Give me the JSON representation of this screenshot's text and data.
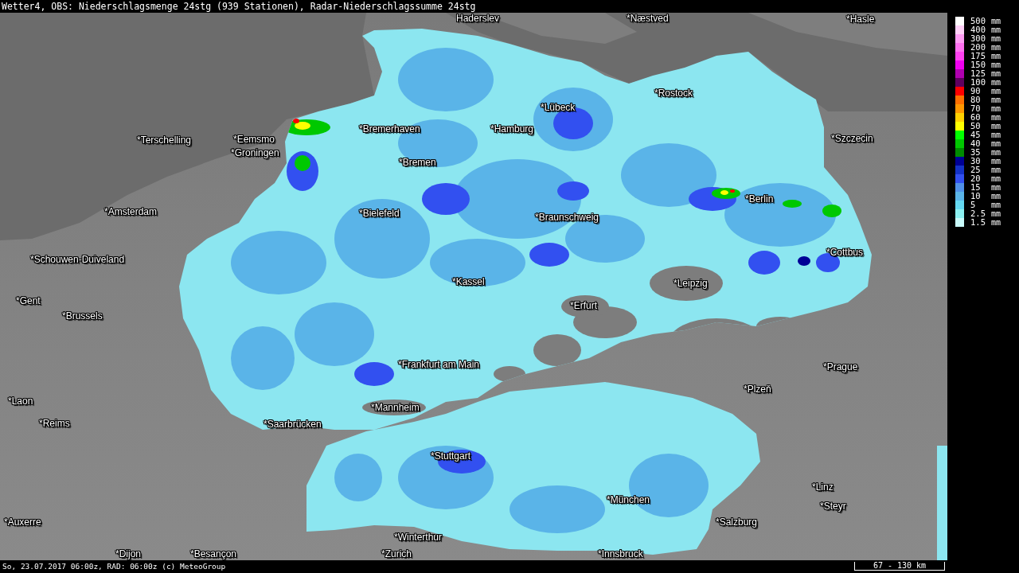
{
  "header": {
    "title": "Wetter4, OBS: Niederschlagsmenge 24stg (939 Stationen), Radar-Niederschlagssumme 24stg"
  },
  "map": {
    "cities": [
      {
        "label": "Haderslev"
      },
      {
        "label": "*Næstved"
      },
      {
        "label": "*Hasle"
      },
      {
        "label": "*Rostock"
      },
      {
        "label": "*Lübeck"
      },
      {
        "label": "*Bremerhaven"
      },
      {
        "label": "*Hamburg"
      },
      {
        "label": "*Terschelling"
      },
      {
        "label": "*Eemsmo"
      },
      {
        "label": "*Szczecin"
      },
      {
        "label": "*Groningen"
      },
      {
        "label": "*Bremen"
      },
      {
        "label": "*Berlin"
      },
      {
        "label": "*Amsterdam"
      },
      {
        "label": "*Bielefeld"
      },
      {
        "label": "*Braunschweig"
      },
      {
        "label": "*Cottbus"
      },
      {
        "label": "*Schouwen-Duiveland"
      },
      {
        "label": "*Kassel"
      },
      {
        "label": "*Leipzig"
      },
      {
        "label": "*Gent"
      },
      {
        "label": "*Erfurt"
      },
      {
        "label": "*Brussels"
      },
      {
        "label": "*Frankfurt am Main"
      },
      {
        "label": "*Prague"
      },
      {
        "label": "*Plzeň"
      },
      {
        "label": "*Laon"
      },
      {
        "label": "*Mannheim"
      },
      {
        "label": "*Reims"
      },
      {
        "label": "*Saarbrücken"
      },
      {
        "label": "*Stuttgart"
      },
      {
        "label": "*Linz"
      },
      {
        "label": "*München"
      },
      {
        "label": "*Steyr"
      },
      {
        "label": "*Auxerre"
      },
      {
        "label": "*Salzburg"
      },
      {
        "label": "*Winterthur"
      },
      {
        "label": "*Dijon"
      },
      {
        "label": "*Besançon"
      },
      {
        "label": "*Zurich"
      },
      {
        "label": "*Innsbruck"
      }
    ]
  },
  "legend": [
    {
      "value": "500",
      "unit": "mm",
      "color": "#ffffff"
    },
    {
      "value": "400",
      "unit": "mm",
      "color": "#ffd0f8"
    },
    {
      "value": "300",
      "unit": "mm",
      "color": "#ff9cf4"
    },
    {
      "value": "200",
      "unit": "mm",
      "color": "#ff70f0"
    },
    {
      "value": "175",
      "unit": "mm",
      "color": "#ff40f0"
    },
    {
      "value": "150",
      "unit": "mm",
      "color": "#f000f0"
    },
    {
      "value": "125",
      "unit": "mm",
      "color": "#b000b0"
    },
    {
      "value": "100",
      "unit": "mm",
      "color": "#600060"
    },
    {
      "value": "90",
      "unit": "mm",
      "color": "#ff0000"
    },
    {
      "value": "80",
      "unit": "mm",
      "color": "#ff7000"
    },
    {
      "value": "70",
      "unit": "mm",
      "color": "#ff9800"
    },
    {
      "value": "60",
      "unit": "mm",
      "color": "#ffd000"
    },
    {
      "value": "50",
      "unit": "mm",
      "color": "#ffff00"
    },
    {
      "value": "45",
      "unit": "mm",
      "color": "#00ff00"
    },
    {
      "value": "40",
      "unit": "mm",
      "color": "#00c800"
    },
    {
      "value": "35",
      "unit": "mm",
      "color": "#008c00"
    },
    {
      "value": "30",
      "unit": "mm",
      "color": "#000096"
    },
    {
      "value": "25",
      "unit": "mm",
      "color": "#1432c8"
    },
    {
      "value": "20",
      "unit": "mm",
      "color": "#3250f0"
    },
    {
      "value": "15",
      "unit": "mm",
      "color": "#5090e8"
    },
    {
      "value": "10",
      "unit": "mm",
      "color": "#5ab4e8"
    },
    {
      "value": "5",
      "unit": "mm",
      "color": "#64d8f0"
    },
    {
      "value": "2.5",
      "unit": "mm",
      "color": "#8cf0f0"
    },
    {
      "value": "1.5",
      "unit": "mm",
      "color": "#c8fafa"
    }
  ],
  "footer": {
    "timestamp": "So, 23.07.2017 06:00z, RAD: 06:00z (c) MeteoGroup",
    "scale": "67 - 130 km"
  }
}
